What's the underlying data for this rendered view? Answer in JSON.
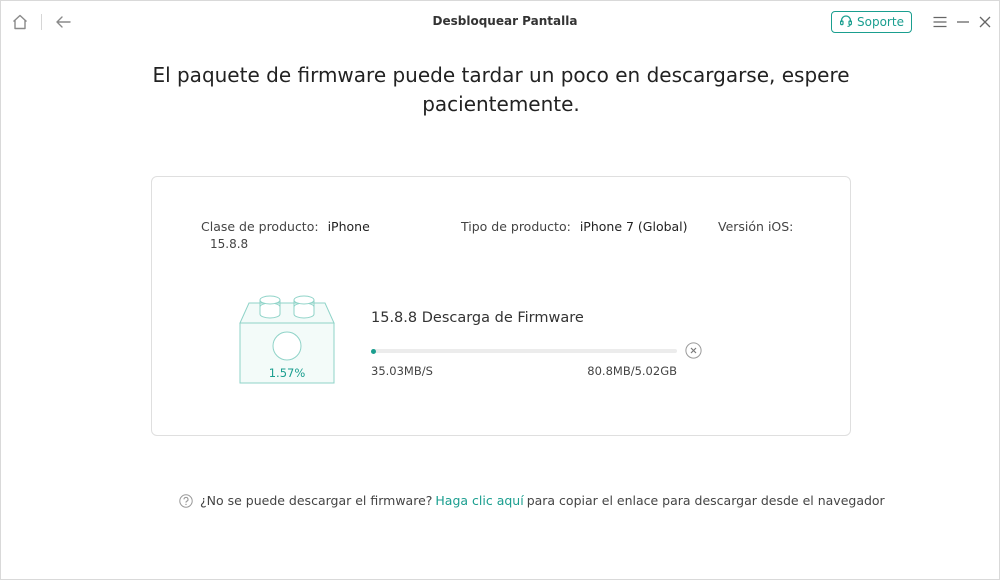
{
  "window": {
    "title": "Desbloquear Pantalla",
    "support_label": "Soporte"
  },
  "heading": "El paquete de firmware puede tardar un poco en descargarse, espere pacientemente.",
  "device": {
    "product_class_label": "Clase de producto:",
    "product_class_value": "iPhone",
    "product_type_label": "Tipo de producto:",
    "product_type_value": "iPhone 7 (Global)",
    "ios_version_label": "Versión iOS:",
    "ios_version_value": "15.8.8"
  },
  "download": {
    "title": "15.8.8 Descarga de Firmware",
    "percent_label": "1.57%",
    "progress_percent": 1.57,
    "speed": "35.03MB/S",
    "size": "80.8MB/5.02GB"
  },
  "help": {
    "prefix": "¿No se puede descargar el firmware?",
    "link": "Haga clic aquí",
    "suffix": "para copiar el enlace para descargar desde el navegador"
  },
  "colors": {
    "accent": "#1a9e8f",
    "illustration_stroke": "#8fd3c8",
    "illustration_fill": "#f3fbf9"
  },
  "icons": {
    "home": "home-icon",
    "back": "back-arrow-icon",
    "support": "headset-icon",
    "menu": "menu-icon",
    "minimize": "minimize-icon",
    "close": "close-icon",
    "cancel": "cancel-circle-icon",
    "help": "question-circle-icon"
  }
}
